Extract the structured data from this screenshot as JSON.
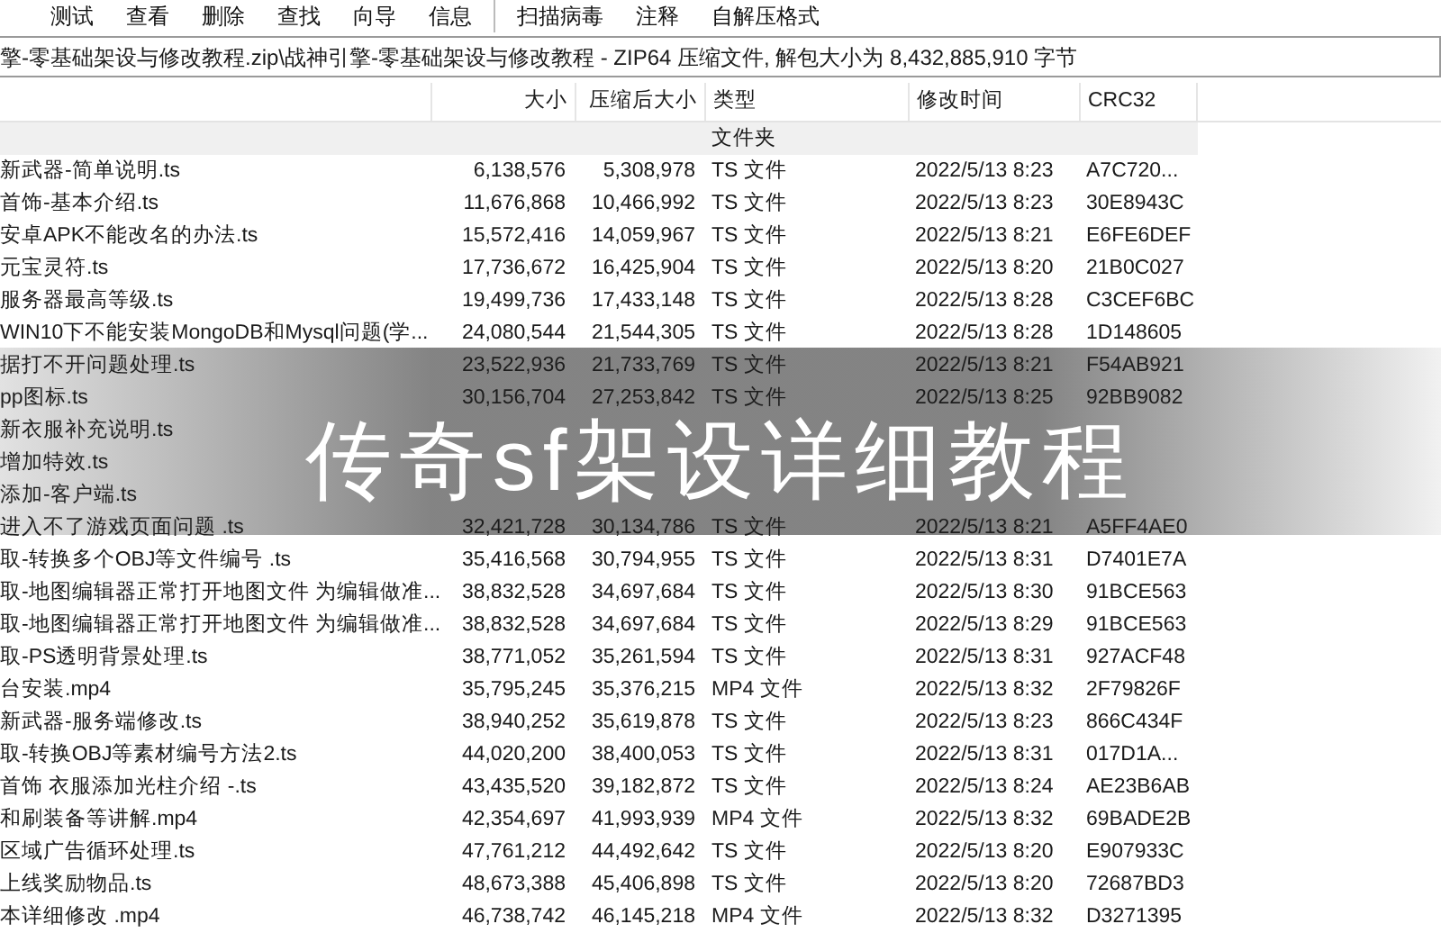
{
  "toolbar": {
    "items": [
      "测试",
      "查看",
      "删除",
      "查找",
      "向导",
      "信息"
    ],
    "items_after_separator": [
      "扫描病毒",
      "注释",
      "自解压格式"
    ]
  },
  "path_bar": "擎-零基础架设与修改教程.zip\\战神引擎-零基础架设与修改教程 - ZIP64 压缩文件, 解包大小为 8,432,885,910 字节",
  "table": {
    "columns": [
      "大小",
      "压缩后大小",
      "类型",
      "修改时间",
      "CRC32"
    ],
    "rows": [
      {
        "kind": "folder",
        "type": "文件夹"
      },
      {
        "kind": "file",
        "name": "新武器-简单说明.ts",
        "size": "6,138,576",
        "packed": "5,308,978",
        "type": "TS 文件",
        "modified": "2022/5/13 8:23",
        "crc": "A7C720..."
      },
      {
        "kind": "file",
        "name": "首饰-基本介绍.ts",
        "size": "11,676,868",
        "packed": "10,466,992",
        "type": "TS 文件",
        "modified": "2022/5/13 8:23",
        "crc": "30E8943C"
      },
      {
        "kind": "file",
        "name": "安卓APK不能改名的办法.ts",
        "size": "15,572,416",
        "packed": "14,059,967",
        "type": "TS 文件",
        "modified": "2022/5/13 8:21",
        "crc": "E6FE6DEF"
      },
      {
        "kind": "file",
        "name": "元宝灵符.ts",
        "size": "17,736,672",
        "packed": "16,425,904",
        "type": "TS 文件",
        "modified": "2022/5/13 8:20",
        "crc": "21B0C027"
      },
      {
        "kind": "file",
        "name": "服务器最高等级.ts",
        "size": "19,499,736",
        "packed": "17,433,148",
        "type": "TS 文件",
        "modified": "2022/5/13 8:28",
        "crc": "C3CEF6BC"
      },
      {
        "kind": "file",
        "name": "WIN10下不能安装MongoDB和Mysql问题(学...",
        "size": "24,080,544",
        "packed": "21,544,305",
        "type": "TS 文件",
        "modified": "2022/5/13 8:28",
        "crc": "1D148605"
      },
      {
        "kind": "file",
        "name": "据打不开问题处理.ts",
        "size": "23,522,936",
        "packed": "21,733,769",
        "type": "TS 文件",
        "modified": "2022/5/13 8:21",
        "crc": "F54AB921"
      },
      {
        "kind": "file",
        "name": "pp图标.ts",
        "size": "30,156,704",
        "packed": "27,253,842",
        "type": "TS 文件",
        "modified": "2022/5/13 8:25",
        "crc": "92BB9082"
      },
      {
        "kind": "file",
        "name": "新衣服补充说明.ts"
      },
      {
        "kind": "file",
        "name": "增加特效.ts"
      },
      {
        "kind": "file",
        "name": "添加-客户端.ts"
      },
      {
        "kind": "file",
        "name": "进入不了游戏页面问题 .ts",
        "size": "32,421,728",
        "packed": "30,134,786",
        "type": "TS 文件",
        "modified": "2022/5/13 8:21",
        "crc": "A5FF4AE0"
      },
      {
        "kind": "file",
        "name": "取-转换多个OBJ等文件编号 .ts",
        "size": "35,416,568",
        "packed": "30,794,955",
        "type": "TS 文件",
        "modified": "2022/5/13 8:31",
        "crc": "D7401E7A"
      },
      {
        "kind": "file",
        "name": "取-地图编辑器正常打开地图文件 为编辑做准...",
        "size": "38,832,528",
        "packed": "34,697,684",
        "type": "TS 文件",
        "modified": "2022/5/13 8:30",
        "crc": "91BCE563"
      },
      {
        "kind": "file",
        "name": "取-地图编辑器正常打开地图文件 为编辑做准...",
        "size": "38,832,528",
        "packed": "34,697,684",
        "type": "TS 文件",
        "modified": "2022/5/13 8:29",
        "crc": "91BCE563"
      },
      {
        "kind": "file",
        "name": "取-PS透明背景处理.ts",
        "size": "38,771,052",
        "packed": "35,261,594",
        "type": "TS 文件",
        "modified": "2022/5/13 8:31",
        "crc": "927ACF48"
      },
      {
        "kind": "file",
        "name": "台安装.mp4",
        "size": "35,795,245",
        "packed": "35,376,215",
        "type": "MP4 文件",
        "modified": "2022/5/13 8:32",
        "crc": "2F79826F"
      },
      {
        "kind": "file",
        "name": "新武器-服务端修改.ts",
        "size": "38,940,252",
        "packed": "35,619,878",
        "type": "TS 文件",
        "modified": "2022/5/13 8:23",
        "crc": "866C434F"
      },
      {
        "kind": "file",
        "name": "取-转换OBJ等素材编号方法2.ts",
        "size": "44,020,200",
        "packed": "38,400,053",
        "type": "TS 文件",
        "modified": "2022/5/13 8:31",
        "crc": "017D1A..."
      },
      {
        "kind": "file",
        "name": "首饰 衣服添加光柱介绍 -.ts",
        "size": "43,435,520",
        "packed": "39,182,872",
        "type": "TS 文件",
        "modified": "2022/5/13 8:24",
        "crc": "AE23B6AB"
      },
      {
        "kind": "file",
        "name": "和刷装备等讲解.mp4",
        "size": "42,354,697",
        "packed": "41,993,939",
        "type": "MP4 文件",
        "modified": "2022/5/13 8:32",
        "crc": "69BADE2B"
      },
      {
        "kind": "file",
        "name": "区域广告循环处理.ts",
        "size": "47,761,212",
        "packed": "44,492,642",
        "type": "TS 文件",
        "modified": "2022/5/13 8:20",
        "crc": "E907933C"
      },
      {
        "kind": "file",
        "name": "上线奖励物品.ts",
        "size": "48,673,388",
        "packed": "45,406,898",
        "type": "TS 文件",
        "modified": "2022/5/13 8:20",
        "crc": "72687BD3"
      },
      {
        "kind": "file",
        "name": "本详细修改 .mp4",
        "size": "46,738,742",
        "packed": "46,145,218",
        "type": "MP4 文件",
        "modified": "2022/5/13 8:32",
        "crc": "D3271395"
      }
    ]
  },
  "banner": {
    "title": "传奇sf架设详细教程"
  }
}
